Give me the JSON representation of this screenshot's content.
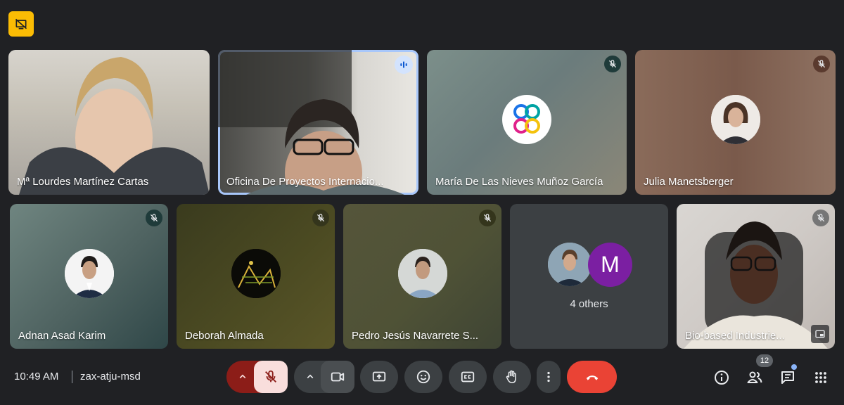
{
  "tiles": [
    {
      "name": "Mª Lourdes Martínez Cartas",
      "muted": false
    },
    {
      "name": "Oficina De Proyectos Internacio...",
      "speaking": true
    },
    {
      "name": "María De Las Nieves Muñoz García",
      "muted": true
    },
    {
      "name": "Julia Manetsberger",
      "muted": true
    },
    {
      "name": "Adnan Asad Karim",
      "muted": true
    },
    {
      "name": "Deborah Almada",
      "muted": true
    },
    {
      "name": "Pedro Jesús Navarrete S...",
      "muted": true
    },
    {
      "name": "4 others",
      "avatar_letter": "M"
    },
    {
      "name": "Bio-based Industrie...",
      "muted": true
    }
  ],
  "bottom_bar": {
    "time": "10:49 AM",
    "meeting_code": "zax-atju-msd",
    "participants_count": "12"
  },
  "colors": {
    "background": "#202124",
    "end_call": "#ea4335",
    "mic_off_bg": "#f9dedc",
    "mic_group_bg": "#8c1d18",
    "top_left_badge": "#fbbc04",
    "others_avatar": "#7b1fa2"
  }
}
